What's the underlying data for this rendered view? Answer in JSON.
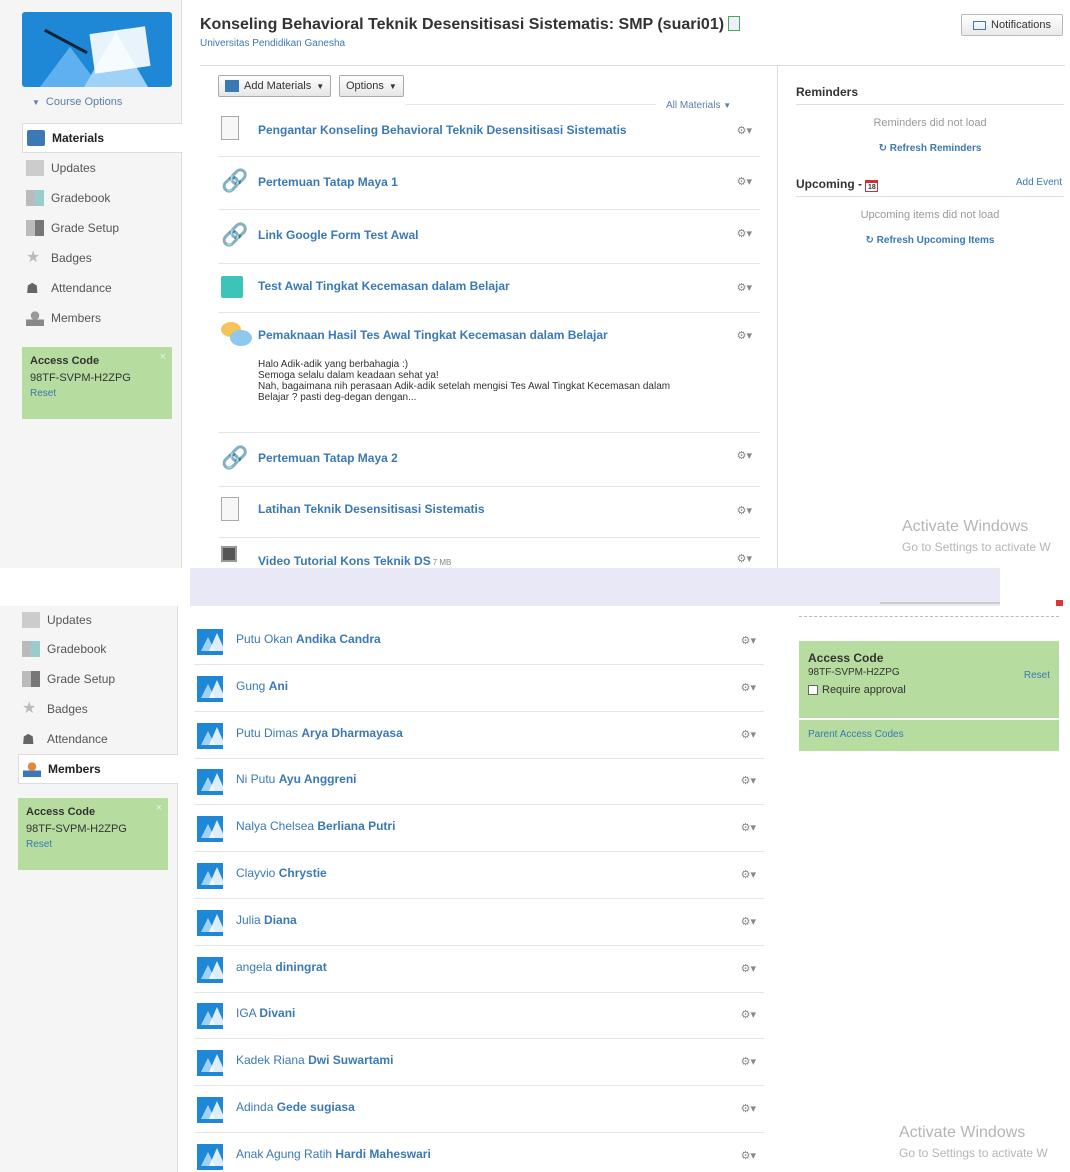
{
  "course": {
    "title": "Konseling Behavioral Teknik Desensitisasi Sistematis: SMP (suari01)",
    "school": "Universitas Pendidikan Ganesha"
  },
  "header": {
    "notifications_label": "Notifications"
  },
  "sidebar": {
    "course_options_label": "Course Options",
    "items": [
      {
        "label": "Materials",
        "icon": "materials-icon"
      },
      {
        "label": "Updates",
        "icon": "updates-icon"
      },
      {
        "label": "Gradebook",
        "icon": "gradebook-icon"
      },
      {
        "label": "Grade Setup",
        "icon": "grade-setup-icon"
      },
      {
        "label": "Badges",
        "icon": "badges-icon"
      },
      {
        "label": "Attendance",
        "icon": "attendance-icon"
      },
      {
        "label": "Members",
        "icon": "members-icon"
      }
    ],
    "access_code": {
      "title": "Access Code",
      "code": "98TF-SVPM-H2ZPG",
      "reset_label": "Reset",
      "close": "×"
    }
  },
  "materials": {
    "add_button": "Add Materials",
    "options_button": "Options",
    "filter_label": "All Materials",
    "items": [
      {
        "title": "Pengantar Konseling Behavioral Teknik Desensitisasi Sistematis",
        "icon": "document-icon"
      },
      {
        "title": "Pertemuan Tatap Maya 1",
        "icon": "link-icon"
      },
      {
        "title": "Link Google Form Test Awal",
        "icon": "link-icon"
      },
      {
        "title": "Test Awal Tingkat Kecemasan dalam Belajar",
        "icon": "assessment-icon"
      },
      {
        "title": "Pemaknaan Hasil Tes Awal Tingkat Kecemasan dalam Belajar",
        "icon": "discussion-icon",
        "body": [
          "Halo Adik-adik yang berbahagia :)",
          "Semoga selalu dalam keadaan sehat ya!",
          "Nah, bagaimana nih perasaan Adik-adik setelah mengisi Tes Awal Tingkat Kecemasan dalam",
          "Belajar ? pasti deg-degan dengan..."
        ]
      },
      {
        "title": "Pertemuan Tatap Maya 2",
        "icon": "link-icon"
      },
      {
        "title": "Latihan Teknik Desensitisasi Sistematis",
        "icon": "document-icon"
      },
      {
        "title": "Video Tutorial Kons Teknik DS",
        "size": "7 MB",
        "icon": "video-icon"
      }
    ]
  },
  "reminders": {
    "title": "Reminders",
    "error": "Reminders did not load",
    "refresh": "Refresh Reminders"
  },
  "upcoming": {
    "title": "Upcoming -",
    "calendar_day": "18",
    "add_event": "Add Event",
    "error": "Upcoming items did not load",
    "refresh": "Refresh Upcoming Items"
  },
  "watermark": {
    "line1": "Activate Windows",
    "line2": "Go to Settings to activate W"
  },
  "members": {
    "list": [
      {
        "first": "Putu Okan",
        "last": "Andika Candra"
      },
      {
        "first": "Gung",
        "last": "Ani"
      },
      {
        "first": "Putu Dimas",
        "last": "Arya Dharmayasa"
      },
      {
        "first": "Ni Putu",
        "last": "Ayu Anggreni"
      },
      {
        "first": "Nalya Chelsea",
        "last": "Berliana Putri"
      },
      {
        "first": "Clayvio",
        "last": "Chrystie"
      },
      {
        "first": "Julia",
        "last": "Diana"
      },
      {
        "first": "angela",
        "last": "diningrat"
      },
      {
        "first": "IGA",
        "last": "Divani"
      },
      {
        "first": "Kadek Riana",
        "last": "Dwi Suwartami"
      },
      {
        "first": "Adinda",
        "last": "Gede sugiasa"
      },
      {
        "first": "Anak Agung Ratih",
        "last": "Hardi Maheswari"
      }
    ]
  },
  "access_panel": {
    "title": "Access Code",
    "code": "98TF-SVPM-H2ZPG",
    "reset": "Reset",
    "require_approval": "Require approval",
    "parent_codes": "Parent Access Codes"
  },
  "colors": {
    "link": "#3a79b5",
    "access_bg": "#b6dca0",
    "brand": "#1e88d6"
  }
}
